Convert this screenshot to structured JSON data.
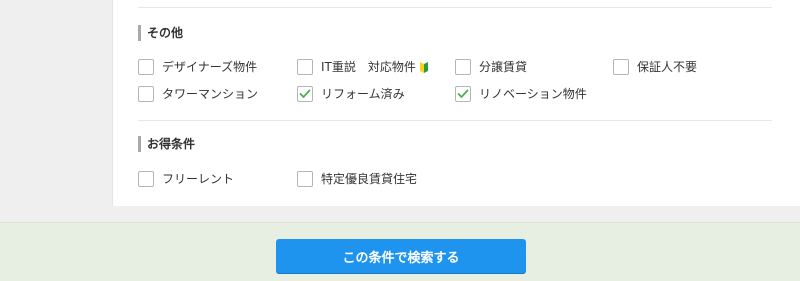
{
  "sections": {
    "other": {
      "title": "その他",
      "options": [
        {
          "label": "デザイナーズ物件",
          "checked": false
        },
        {
          "label": "IT重説　対応物件",
          "checked": false,
          "icon": "beginner-mark-icon"
        },
        {
          "label": "分譲賃貸",
          "checked": false
        },
        {
          "label": "保証人不要",
          "checked": false
        },
        {
          "label": "タワーマンション",
          "checked": false
        },
        {
          "label": "リフォーム済み",
          "checked": true
        },
        {
          "label": "リノベーション物件",
          "checked": true
        }
      ]
    },
    "deals": {
      "title": "お得条件",
      "options": [
        {
          "label": "フリーレント",
          "checked": false
        },
        {
          "label": "特定優良賃貸住宅",
          "checked": false
        }
      ]
    }
  },
  "search_button": {
    "label": "この条件で検索する"
  },
  "colors": {
    "accent": "#1e94ef",
    "checkmark": "#4caf50",
    "footer_bg": "#e7efe2",
    "leaf_yellow": "#f2d41a",
    "leaf_green": "#2e9a3f"
  }
}
